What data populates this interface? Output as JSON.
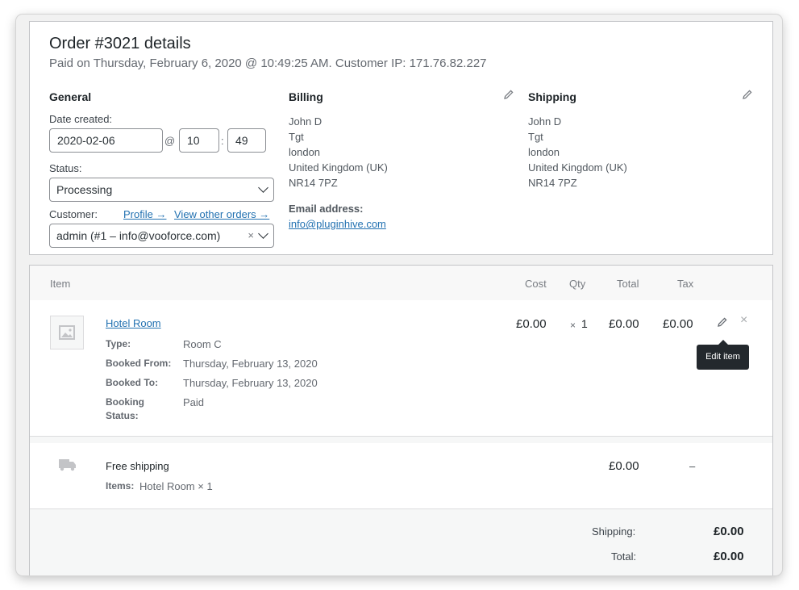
{
  "order": {
    "title": "Order #3021 details",
    "subtitle": "Paid on Thursday, February 6, 2020 @ 10:49:25 AM. Customer IP: 171.76.82.227"
  },
  "general": {
    "heading": "General",
    "date_label": "Date created:",
    "date_value": "2020-02-06",
    "at_sep": "@",
    "hour_value": "10",
    "time_sep": ":",
    "minute_value": "49",
    "status_label": "Status:",
    "status_value": "Processing",
    "customer_label": "Customer:",
    "profile_link": "Profile →",
    "other_orders_link": "View other orders →",
    "customer_value": "admin (#1 – info@vooforce.com)",
    "clear_glyph": "×"
  },
  "billing": {
    "heading": "Billing",
    "lines": [
      "John D",
      "Tgt",
      "london",
      "United Kingdom (UK)",
      "NR14 7PZ"
    ],
    "email_label": "Email address:",
    "email_value": "info@pluginhive.com"
  },
  "shipping": {
    "heading": "Shipping",
    "lines": [
      "John D",
      "Tgt",
      "london",
      "United Kingdom (UK)",
      "NR14 7PZ"
    ]
  },
  "items_table": {
    "headers": {
      "item": "Item",
      "cost": "Cost",
      "qty": "Qty",
      "total": "Total",
      "tax": "Tax"
    },
    "line_item": {
      "name": "Hotel Room",
      "meta": [
        {
          "key": "Type:",
          "value": "Room C"
        },
        {
          "key": "Booked From:",
          "value": "Thursday, February 13, 2020"
        },
        {
          "key": "Booked To:",
          "value": "Thursday, February 13, 2020"
        },
        {
          "key": "Booking",
          "key2": "Status:",
          "value": "Paid"
        }
      ],
      "cost": "£0.00",
      "qty_prefix": "×",
      "qty": "1",
      "total": "£0.00",
      "tax": "£0.00",
      "tooltip": "Edit item",
      "delete_glyph": "×"
    },
    "shipping_line": {
      "name": "Free shipping",
      "items_label": "Items:",
      "items_value": "Hotel Room × 1",
      "total": "£0.00",
      "tax": "–"
    }
  },
  "totals": {
    "shipping_label": "Shipping:",
    "shipping_value": "£0.00",
    "total_label": "Total:",
    "total_value": "£0.00"
  },
  "colors": {
    "link": "#2271b1",
    "tooltip_bg": "#23282d",
    "border": "#c3c4c7"
  }
}
